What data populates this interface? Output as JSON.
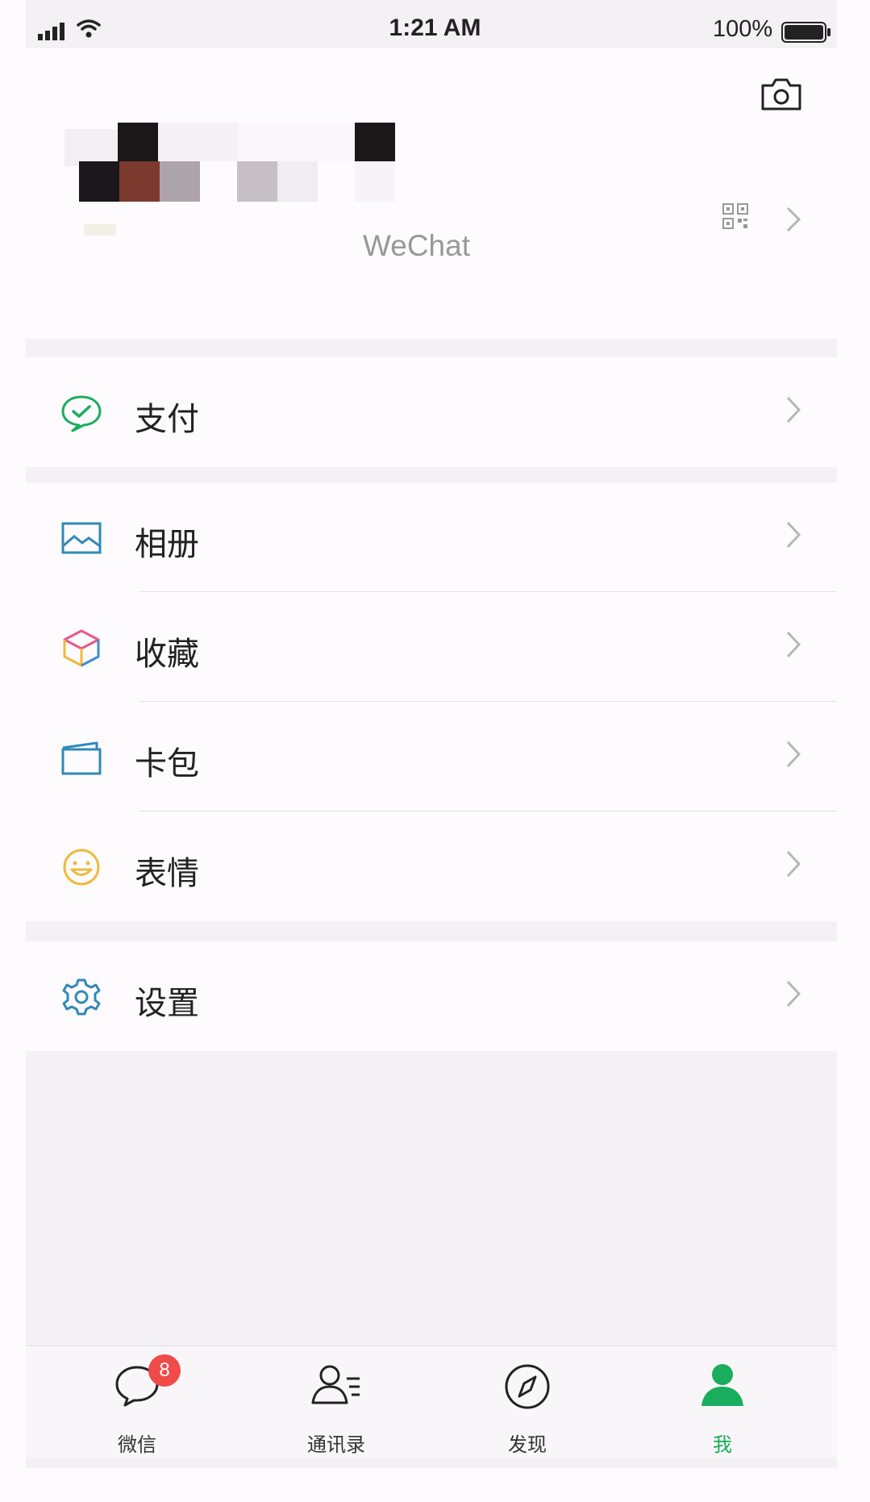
{
  "status_bar": {
    "time": "1:21 AM",
    "battery_percent": "100%",
    "battery_level": 1.0
  },
  "header": {
    "camera_icon": "camera-icon"
  },
  "profile": {
    "wechat_id_label": "WeChat",
    "qr_icon": "qr-code-icon"
  },
  "menu": {
    "pay": "支付",
    "album": "相册",
    "favorites": "收藏",
    "cards": "卡包",
    "stickers": "表情",
    "settings": "设置"
  },
  "tabs": [
    {
      "label": "微信",
      "icon": "chat-bubble-icon",
      "badge": "8"
    },
    {
      "label": "通讯录",
      "icon": "contacts-icon"
    },
    {
      "label": "发现",
      "icon": "compass-icon"
    },
    {
      "label": "我",
      "icon": "person-icon",
      "active": true
    }
  ],
  "colors": {
    "brand_green": "#1aad5d",
    "badge_red": "#f04a4a",
    "background": "#fdfbfd"
  }
}
